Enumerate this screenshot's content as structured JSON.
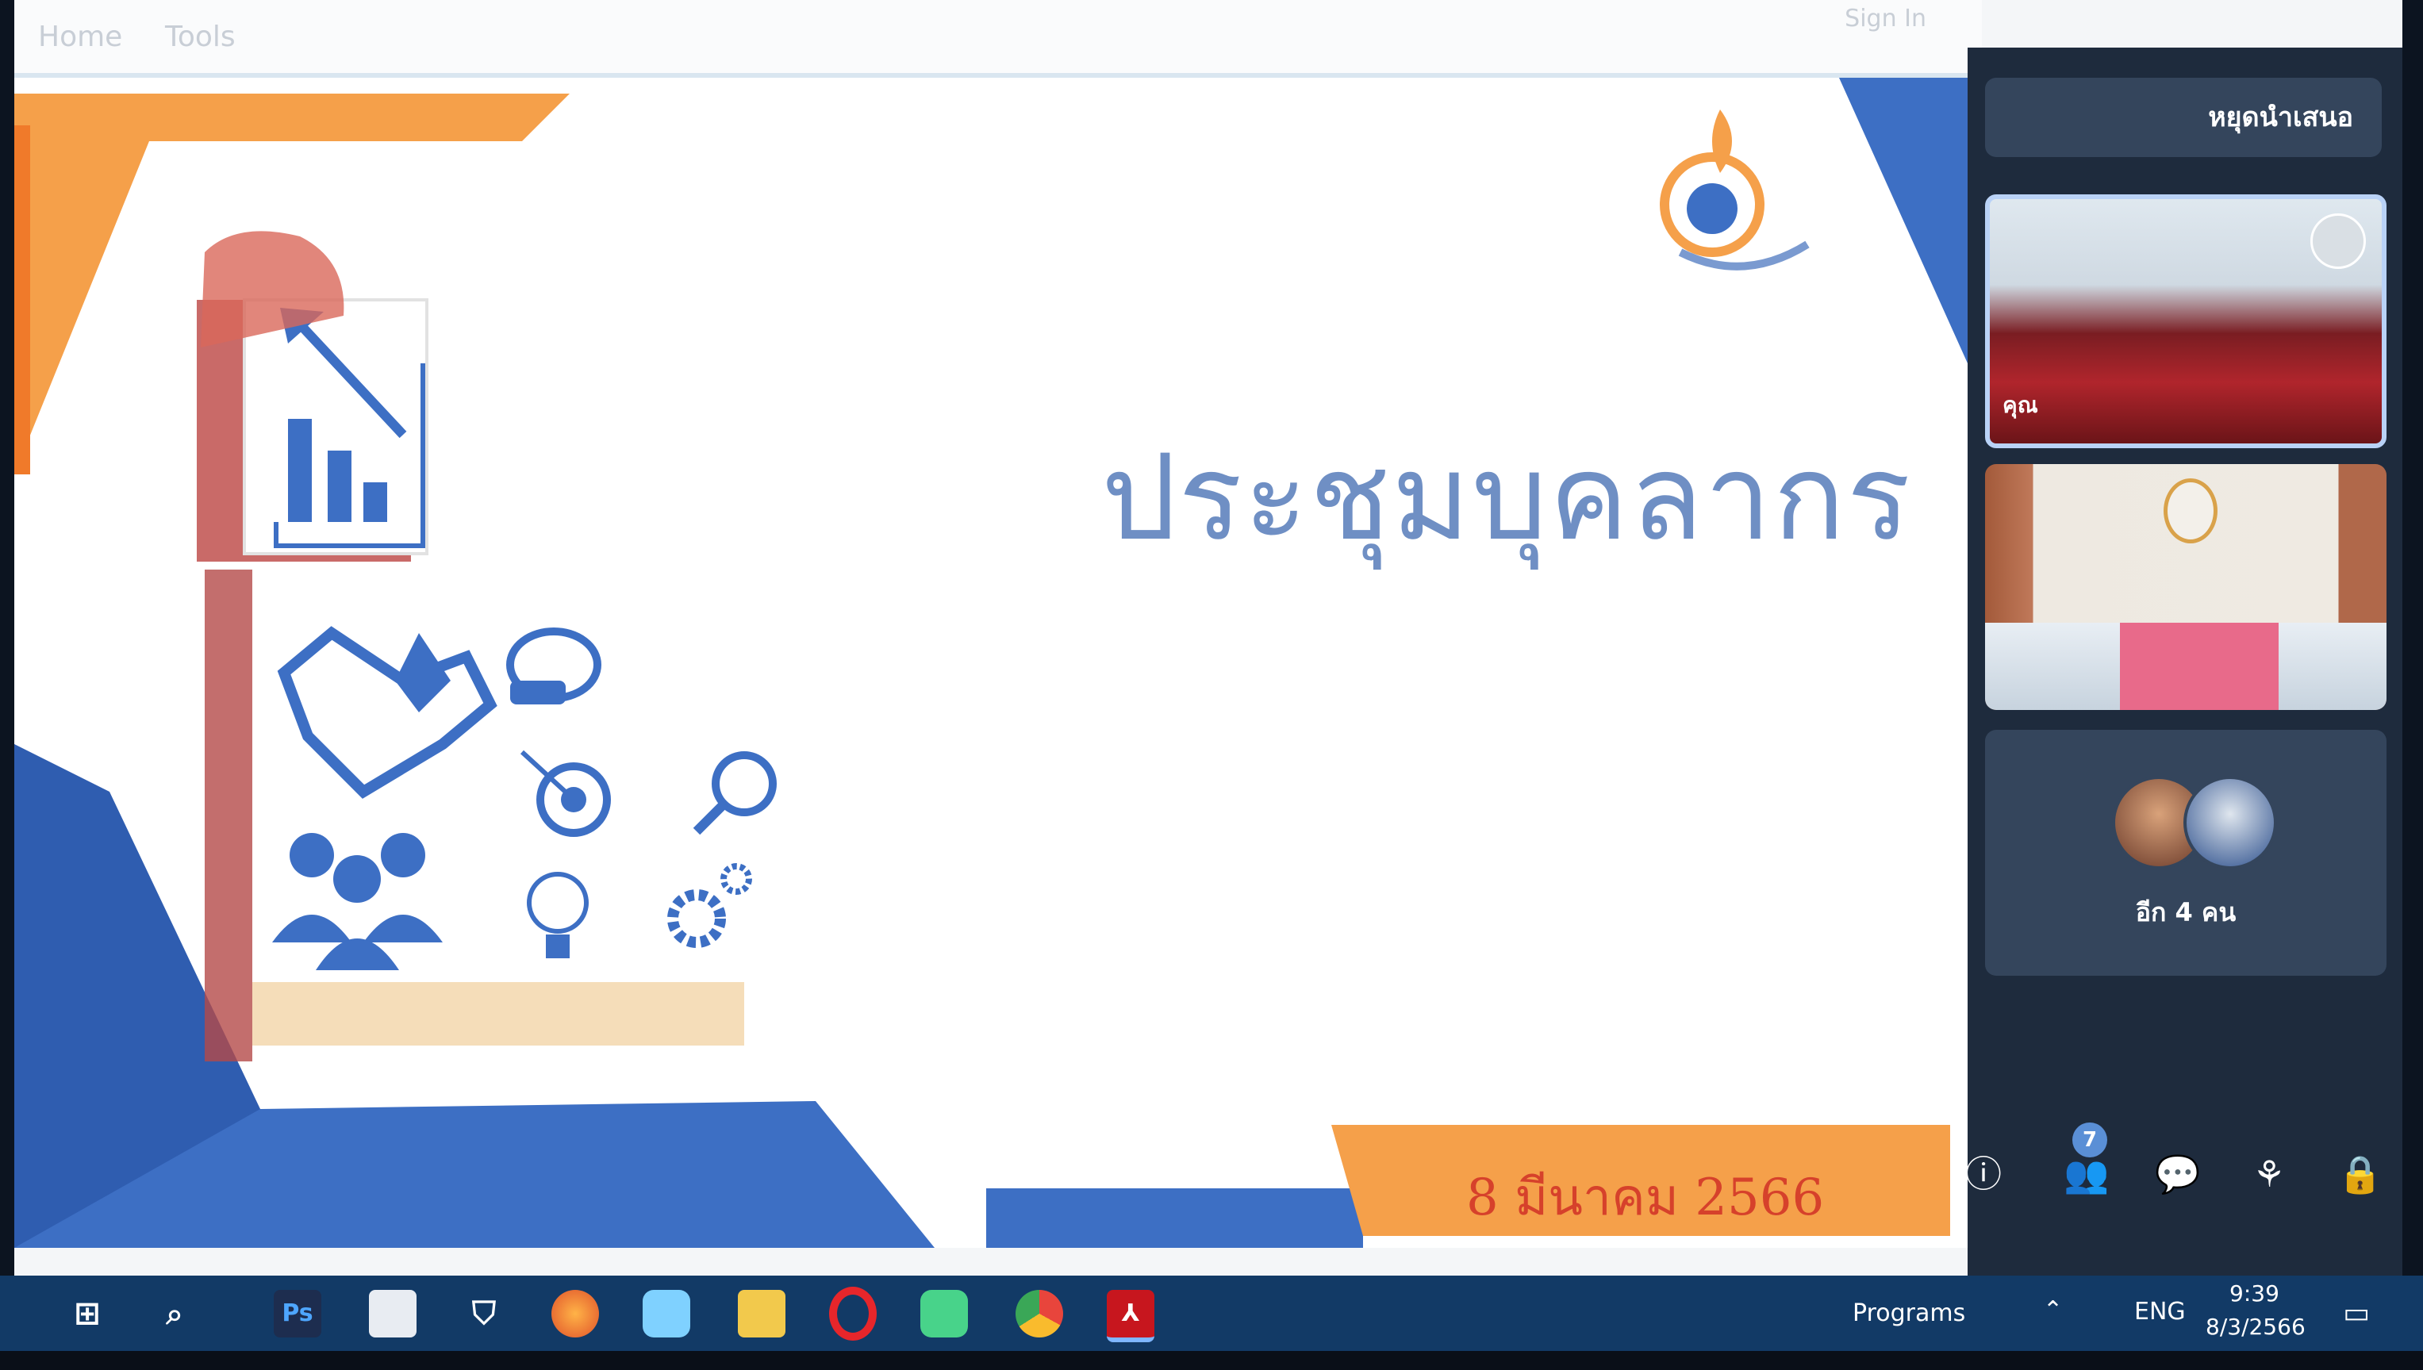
{
  "app_bar": {
    "menu_home": "Home",
    "menu_tools": "Tools",
    "sign_in": "Sign In"
  },
  "slide": {
    "title": "ประชุมบุคลากร",
    "date": "8 มีนาคม 2566"
  },
  "meeting_panel": {
    "stop_presenting": "หยุดนำเสนอ",
    "participant_name": "คุณ",
    "others_label": "อีก 4 คน",
    "participants_badge": "7",
    "controls": [
      "info-icon",
      "people-icon",
      "chat-icon",
      "activities-icon",
      "lock-icon"
    ]
  },
  "taskbar": {
    "apps": [
      "windows-start-icon",
      "search-icon",
      "photoshop-icon",
      "file-icon",
      "shield-icon",
      "firefox-icon",
      "chat-app-icon",
      "folder-icon",
      "opera-icon",
      "line-icon",
      "chrome-icon",
      "acrobat-icon"
    ],
    "photoshop_label": "Ps",
    "programs": "Programs",
    "language": "ENG",
    "time": "9:39",
    "date": "8/3/2566"
  },
  "colors": {
    "slide_blue": "#3d6fc4",
    "slide_orange": "#f5a04a",
    "title_blue": "#6f8fc4",
    "date_red": "#d6412b",
    "panel_bg": "#1e2b3d",
    "taskbar_bg": "#123a66"
  }
}
